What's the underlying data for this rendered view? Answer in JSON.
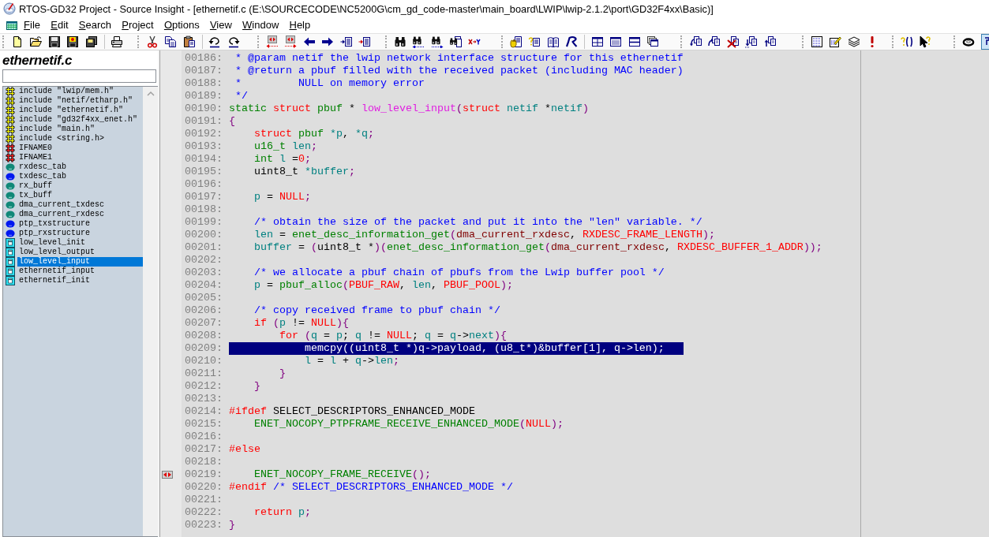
{
  "window": {
    "title": "RTOS-GD32 Project - Source Insight - [ethernetif.c (E:\\SOURCECODE\\NC5200G\\cm_gd_code-master\\main_board\\LWIP\\lwip-2.1.2\\port\\GD32F4xx\\Basic)]"
  },
  "menu": [
    "File",
    "Edit",
    "Search",
    "Project",
    "Options",
    "View",
    "Window",
    "Help"
  ],
  "symbol_window": {
    "file_name": "ethernetif.c",
    "symbols": [
      {
        "kind": "include",
        "label": "include \"lwip/mem.h\"",
        "selected": false
      },
      {
        "kind": "include",
        "label": "include \"netif/etharp.h\"",
        "selected": false
      },
      {
        "kind": "include",
        "label": "include \"ethernetif.h\"",
        "selected": false
      },
      {
        "kind": "include",
        "label": "include \"gd32f4xx_enet.h\"",
        "selected": false
      },
      {
        "kind": "include",
        "label": "include \"main.h\"",
        "selected": false
      },
      {
        "kind": "include",
        "label": "include <string.h>",
        "selected": false
      },
      {
        "kind": "define",
        "label": "IFNAME0",
        "selected": false
      },
      {
        "kind": "define",
        "label": "IFNAME1",
        "selected": false
      },
      {
        "kind": "variable",
        "label": "rxdesc_tab",
        "selected": false
      },
      {
        "kind": "static",
        "label": "txdesc_tab",
        "selected": false
      },
      {
        "kind": "variable",
        "label": "rx_buff",
        "selected": false
      },
      {
        "kind": "variable",
        "label": "tx_buff",
        "selected": false
      },
      {
        "kind": "variable",
        "label": "dma_current_txdesc",
        "selected": false
      },
      {
        "kind": "variable",
        "label": "dma_current_rxdesc",
        "selected": false
      },
      {
        "kind": "static",
        "label": "ptp_txstructure",
        "selected": false
      },
      {
        "kind": "static",
        "label": "ptp_rxstructure",
        "selected": false
      },
      {
        "kind": "function",
        "label": "low_level_init",
        "selected": false
      },
      {
        "kind": "function",
        "label": "low_level_output",
        "selected": false
      },
      {
        "kind": "function",
        "label": "low_level_input",
        "selected": true
      },
      {
        "kind": "function",
        "label": "ethernetif_input",
        "selected": false
      },
      {
        "kind": "function",
        "label": "ethernetif_init",
        "selected": false
      }
    ]
  },
  "editor": {
    "lines": [
      {
        "number": "00186:",
        "selected": false,
        "bookmark": false,
        "tokens": [
          {
            "kind": "comment",
            "text": " * @param netif the lwip network interface structure for this ethernetif"
          }
        ]
      },
      {
        "number": "00187:",
        "selected": false,
        "bookmark": false,
        "tokens": [
          {
            "kind": "comment",
            "text": " * @return a pbuf filled with the received packet (including MAC header)"
          }
        ]
      },
      {
        "number": "00188:",
        "selected": false,
        "bookmark": false,
        "tokens": [
          {
            "kind": "comment",
            "text": " *         NULL on memory error"
          }
        ]
      },
      {
        "number": "00189:",
        "selected": false,
        "bookmark": false,
        "tokens": [
          {
            "kind": "comment",
            "text": " */"
          }
        ]
      },
      {
        "number": "00190:",
        "selected": false,
        "bookmark": false,
        "tokens": [
          {
            "kind": "type",
            "text": "static"
          },
          {
            "kind": "keyword",
            "text": " struct"
          },
          {
            "kind": "type",
            "text": " pbuf"
          },
          {
            "kind": "plain",
            "text": " * "
          },
          {
            "kind": "declaration",
            "text": "low_level_input"
          },
          {
            "kind": "punct",
            "text": "("
          },
          {
            "kind": "keyword",
            "text": "struct"
          },
          {
            "kind": "variable",
            "text": " netif"
          },
          {
            "kind": "plain",
            "text": " *"
          },
          {
            "kind": "variable",
            "text": "netif"
          },
          {
            "kind": "punct",
            "text": ")"
          }
        ]
      },
      {
        "number": "00191:",
        "selected": false,
        "bookmark": false,
        "tokens": [
          {
            "kind": "punct",
            "text": "{"
          }
        ]
      },
      {
        "number": "00192:",
        "selected": false,
        "bookmark": false,
        "tokens": [
          {
            "kind": "keyword",
            "text": "    struct"
          },
          {
            "kind": "type",
            "text": " pbuf"
          },
          {
            "kind": "variable",
            "text": " *p"
          },
          {
            "kind": "plain",
            "text": ", "
          },
          {
            "kind": "variable",
            "text": "*q"
          },
          {
            "kind": "punct",
            "text": ";"
          }
        ]
      },
      {
        "number": "00193:",
        "selected": false,
        "bookmark": false,
        "tokens": [
          {
            "kind": "type",
            "text": "    u16_t"
          },
          {
            "kind": "variable",
            "text": " len"
          },
          {
            "kind": "punct",
            "text": ";"
          }
        ]
      },
      {
        "number": "00194:",
        "selected": false,
        "bookmark": false,
        "tokens": [
          {
            "kind": "type",
            "text": "    int"
          },
          {
            "kind": "variable",
            "text": " l"
          },
          {
            "kind": "plain",
            "text": " ="
          },
          {
            "kind": "constant",
            "text": "0"
          },
          {
            "kind": "punct",
            "text": ";"
          }
        ]
      },
      {
        "number": "00195:",
        "selected": false,
        "bookmark": false,
        "tokens": [
          {
            "kind": "plain",
            "text": "    uint8_t "
          },
          {
            "kind": "variable",
            "text": "*buffer"
          },
          {
            "kind": "punct",
            "text": ";"
          }
        ]
      },
      {
        "number": "00196:",
        "selected": false,
        "bookmark": false
      },
      {
        "number": "00197:",
        "selected": false,
        "bookmark": false,
        "tokens": [
          {
            "kind": "variable",
            "text": "    p"
          },
          {
            "kind": "plain",
            "text": " = "
          },
          {
            "kind": "constant",
            "text": "NULL"
          },
          {
            "kind": "punct",
            "text": ";"
          }
        ]
      },
      {
        "number": "00198:",
        "selected": false,
        "bookmark": false
      },
      {
        "number": "00199:",
        "selected": false,
        "bookmark": false,
        "tokens": [
          {
            "kind": "comment",
            "text": "    /* obtain the size of the packet and put it into the \"len\" variable. */"
          }
        ]
      },
      {
        "number": "00200:",
        "selected": false,
        "bookmark": false,
        "tokens": [
          {
            "kind": "variable",
            "text": "    len"
          },
          {
            "kind": "plain",
            "text": " = "
          },
          {
            "kind": "call",
            "text": "enet_desc_information_get"
          },
          {
            "kind": "punct",
            "text": "("
          },
          {
            "kind": "global",
            "text": "dma_current_rxdesc"
          },
          {
            "kind": "plain",
            "text": ", "
          },
          {
            "kind": "constant",
            "text": "RXDESC_FRAME_LENGTH"
          },
          {
            "kind": "punct",
            "text": ");"
          }
        ]
      },
      {
        "number": "00201:",
        "selected": false,
        "bookmark": false,
        "tokens": [
          {
            "kind": "variable",
            "text": "    buffer"
          },
          {
            "kind": "plain",
            "text": " = "
          },
          {
            "kind": "punct",
            "text": "("
          },
          {
            "kind": "plain",
            "text": "uint8_t *"
          },
          {
            "kind": "punct",
            "text": ")("
          },
          {
            "kind": "call",
            "text": "enet_desc_information_get"
          },
          {
            "kind": "punct",
            "text": "("
          },
          {
            "kind": "global",
            "text": "dma_current_rxdesc"
          },
          {
            "kind": "plain",
            "text": ", "
          },
          {
            "kind": "constant",
            "text": "RXDESC_BUFFER_1_ADDR"
          },
          {
            "kind": "punct",
            "text": "));"
          }
        ]
      },
      {
        "number": "00202:",
        "selected": false,
        "bookmark": false
      },
      {
        "number": "00203:",
        "selected": false,
        "bookmark": false,
        "tokens": [
          {
            "kind": "comment",
            "text": "    /* we allocate a pbuf chain of pbufs from the Lwip buffer pool */"
          }
        ]
      },
      {
        "number": "00204:",
        "selected": false,
        "bookmark": false,
        "tokens": [
          {
            "kind": "variable",
            "text": "    p"
          },
          {
            "kind": "plain",
            "text": " = "
          },
          {
            "kind": "call",
            "text": "pbuf_alloc"
          },
          {
            "kind": "punct",
            "text": "("
          },
          {
            "kind": "constant",
            "text": "PBUF_RAW"
          },
          {
            "kind": "plain",
            "text": ", "
          },
          {
            "kind": "variable",
            "text": "len"
          },
          {
            "kind": "plain",
            "text": ", "
          },
          {
            "kind": "constant",
            "text": "PBUF_POOL"
          },
          {
            "kind": "punct",
            "text": ");"
          }
        ]
      },
      {
        "number": "00205:",
        "selected": false,
        "bookmark": false
      },
      {
        "number": "00206:",
        "selected": false,
        "bookmark": false,
        "tokens": [
          {
            "kind": "comment",
            "text": "    /* copy received frame to pbuf chain */"
          }
        ]
      },
      {
        "number": "00207:",
        "selected": false,
        "bookmark": false,
        "tokens": [
          {
            "kind": "keyword",
            "text": "    if"
          },
          {
            "kind": "punct",
            "text": " ("
          },
          {
            "kind": "variable",
            "text": "p"
          },
          {
            "kind": "plain",
            "text": " != "
          },
          {
            "kind": "constant",
            "text": "NULL"
          },
          {
            "kind": "punct",
            "text": "){"
          }
        ]
      },
      {
        "number": "00208:",
        "selected": false,
        "bookmark": false,
        "tokens": [
          {
            "kind": "keyword",
            "text": "        for"
          },
          {
            "kind": "punct",
            "text": " ("
          },
          {
            "kind": "variable",
            "text": "q"
          },
          {
            "kind": "plain",
            "text": " = "
          },
          {
            "kind": "variable",
            "text": "p"
          },
          {
            "kind": "plain",
            "text": "; "
          },
          {
            "kind": "variable",
            "text": "q"
          },
          {
            "kind": "plain",
            "text": " != "
          },
          {
            "kind": "constant",
            "text": "NULL"
          },
          {
            "kind": "plain",
            "text": "; "
          },
          {
            "kind": "variable",
            "text": "q"
          },
          {
            "kind": "plain",
            "text": " = "
          },
          {
            "kind": "variable",
            "text": "q"
          },
          {
            "kind": "plain",
            "text": "->"
          },
          {
            "kind": "variable",
            "text": "next"
          },
          {
            "kind": "punct",
            "text": "){"
          }
        ]
      },
      {
        "number": "00209:",
        "selected": true,
        "bookmark": false,
        "text": "            memcpy((uint8_t *)q->payload, (u8_t*)&buffer[1], q->len);"
      },
      {
        "number": "00210:",
        "selected": false,
        "bookmark": false,
        "tokens": [
          {
            "kind": "variable",
            "text": "            l"
          },
          {
            "kind": "plain",
            "text": " = "
          },
          {
            "kind": "variable",
            "text": "l"
          },
          {
            "kind": "plain",
            "text": " + "
          },
          {
            "kind": "variable",
            "text": "q"
          },
          {
            "kind": "plain",
            "text": "->"
          },
          {
            "kind": "variable",
            "text": "len"
          },
          {
            "kind": "punct",
            "text": ";"
          }
        ]
      },
      {
        "number": "00211:",
        "selected": false,
        "bookmark": false,
        "tokens": [
          {
            "kind": "punct",
            "text": "        }"
          }
        ]
      },
      {
        "number": "00212:",
        "selected": false,
        "bookmark": false,
        "tokens": [
          {
            "kind": "punct",
            "text": "    }"
          }
        ]
      },
      {
        "number": "00213:",
        "selected": false,
        "bookmark": false
      },
      {
        "number": "00214:",
        "selected": false,
        "bookmark": false,
        "tokens": [
          {
            "kind": "keyword",
            "text": "#ifdef"
          },
          {
            "kind": "plain",
            "text": " SELECT_DESCRIPTORS_ENHANCED_MODE"
          }
        ]
      },
      {
        "number": "00215:",
        "selected": false,
        "bookmark": false,
        "tokens": [
          {
            "kind": "call",
            "text": "    ENET_NOCOPY_PTPFRAME_RECEIVE_ENHANCED_MODE"
          },
          {
            "kind": "punct",
            "text": "("
          },
          {
            "kind": "constant",
            "text": "NULL"
          },
          {
            "kind": "punct",
            "text": ");"
          }
        ]
      },
      {
        "number": "00216:",
        "selected": false,
        "bookmark": false
      },
      {
        "number": "00217:",
        "selected": false,
        "bookmark": false,
        "tokens": [
          {
            "kind": "keyword",
            "text": "#else"
          }
        ]
      },
      {
        "number": "00218:",
        "selected": false,
        "bookmark": false
      },
      {
        "number": "00219:",
        "selected": false,
        "bookmark": true,
        "tokens": [
          {
            "kind": "call",
            "text": "    ENET_NOCOPY_FRAME_RECEIVE"
          },
          {
            "kind": "punct",
            "text": "();"
          }
        ]
      },
      {
        "number": "00220:",
        "selected": false,
        "bookmark": false,
        "tokens": [
          {
            "kind": "keyword",
            "text": "#endif"
          },
          {
            "kind": "comment",
            "text": " /* SELECT_DESCRIPTORS_ENHANCED_MODE */"
          }
        ]
      },
      {
        "number": "00221:",
        "selected": false,
        "bookmark": false
      },
      {
        "number": "00222:",
        "selected": false,
        "bookmark": false,
        "tokens": [
          {
            "kind": "keyword",
            "text": "    return"
          },
          {
            "kind": "variable",
            "text": " p"
          },
          {
            "kind": "punct",
            "text": ";"
          }
        ]
      },
      {
        "number": "00223:",
        "selected": false,
        "bookmark": false,
        "tokens": [
          {
            "kind": "punct",
            "text": "}"
          }
        ]
      }
    ]
  }
}
